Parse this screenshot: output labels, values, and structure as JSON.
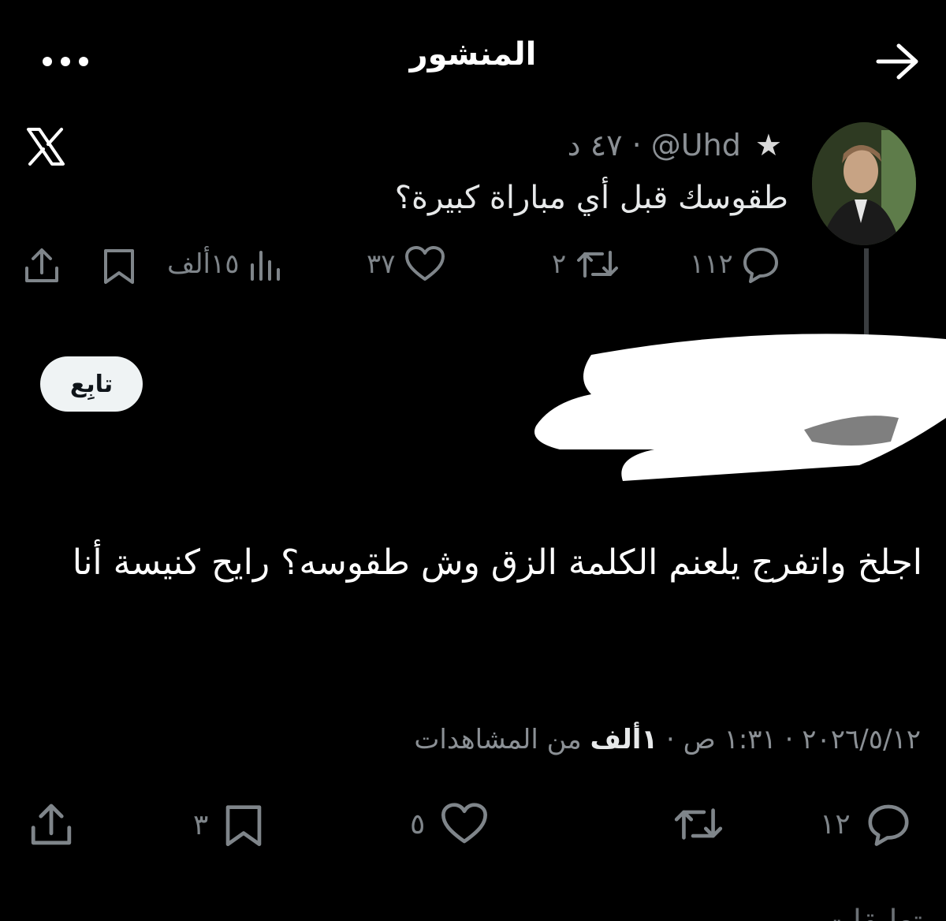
{
  "header": {
    "title": "المنشور"
  },
  "quoted_post": {
    "star": "★",
    "handle": "@Uhd",
    "separator": "·",
    "time": "٤٧ د",
    "text": "طقوسك قبل أي مباراة كبيرة؟",
    "actions": {
      "replies": "١١٢",
      "reposts": "٢",
      "likes": "٣٧",
      "views": "١٥ألف"
    }
  },
  "follow": {
    "label": "تابِع"
  },
  "main_post": {
    "text": "اجلخ واتفرج يلعنم الكلمة الزق وش طقوسه؟ رايح كنيسة أنا",
    "meta": {
      "date": "٢٠٢٦/٥/١٢",
      "time": "١:٣١ ص",
      "views": "١ألف",
      "views_suffix": "من المشاهدات"
    },
    "actions": {
      "replies": "١٢",
      "reposts": "",
      "likes": "٥",
      "bookmarks": "٣"
    }
  },
  "bottom_partial_text": "تعليقات",
  "colors": {
    "background": "#000000",
    "text": "#e7e9ea",
    "muted": "#8b9095",
    "follow_bg": "#eff3f4"
  },
  "icons": [
    "back-arrow-icon",
    "more-icon",
    "x-logo-icon",
    "reply-icon",
    "repost-icon",
    "like-icon",
    "views-icon",
    "bookmark-icon",
    "share-icon"
  ]
}
